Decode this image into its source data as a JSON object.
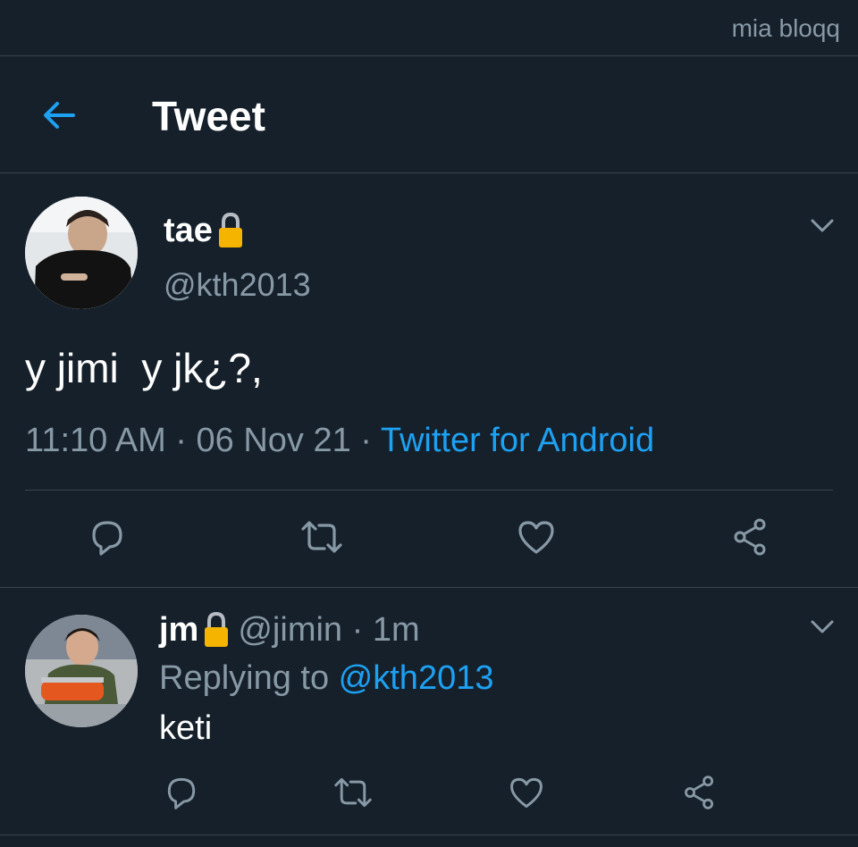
{
  "watermark": "mia bloqq",
  "header": {
    "title": "Tweet",
    "back_icon": "arrow-left-icon"
  },
  "colors": {
    "background": "#15202b",
    "accent": "#1da1f2",
    "secondary_text": "#8899a6",
    "divider": "#38444d",
    "lock": "#f5b400"
  },
  "tweet": {
    "display_name": "tae",
    "handle": "@kth2013",
    "text": "y jimi  y jk¿?,",
    "time": "11:10 AM",
    "separator1": " · ",
    "date": "06 Nov 21",
    "separator2": " · ",
    "source": "Twitter for Android",
    "protected": true
  },
  "actions": [
    "reply-icon",
    "retweet-icon",
    "like-icon",
    "share-icon"
  ],
  "reply": {
    "display_name": "jm",
    "handle_time": "@jimin · 1m",
    "replying_prefix": "Replying to ",
    "replying_to": "@kth2013",
    "text": "keti",
    "protected": true
  }
}
